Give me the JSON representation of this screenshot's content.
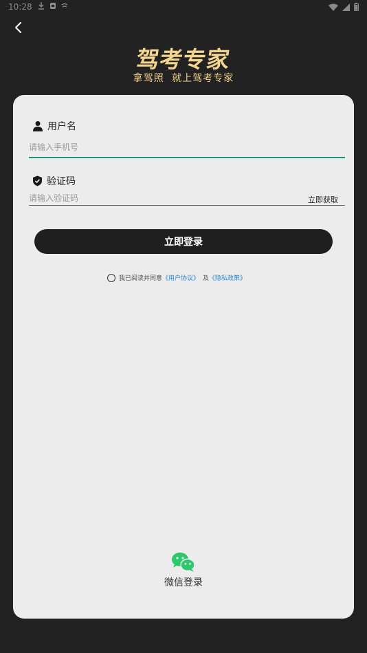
{
  "status_bar": {
    "time": "10:28",
    "icons": [
      "download-icon",
      "app-icon",
      "signal-small-icon",
      "wifi-icon",
      "cell-signal-icon",
      "battery-icon"
    ]
  },
  "header": {
    "back_icon": "chevron-left-icon",
    "title": "驾考专家",
    "slogan": "拿驾照 就上驾考专家"
  },
  "form": {
    "username": {
      "icon": "user-icon",
      "label": "用户名",
      "placeholder": "请输入手机号",
      "value": ""
    },
    "code": {
      "icon": "shield-icon",
      "label": "验证码",
      "placeholder": "请输入验证码",
      "value": "",
      "get_code_label": "立即获取"
    },
    "login_label": "立即登录"
  },
  "agreement": {
    "checked": false,
    "prefix": "我已阅读并同意",
    "user_agreement": "《用户协议》",
    "and": "及",
    "privacy_policy": "《隐私政策》"
  },
  "wechat_login": {
    "icon": "wechat-icon",
    "label": "微信登录"
  },
  "colors": {
    "background": "#222222",
    "brand": "#f3d58f",
    "card": "#ececec",
    "accent_underline": "#1f8f7f",
    "button": "#1f1f1f",
    "link": "#2a8ad6",
    "wechat": "#2dc86b"
  }
}
